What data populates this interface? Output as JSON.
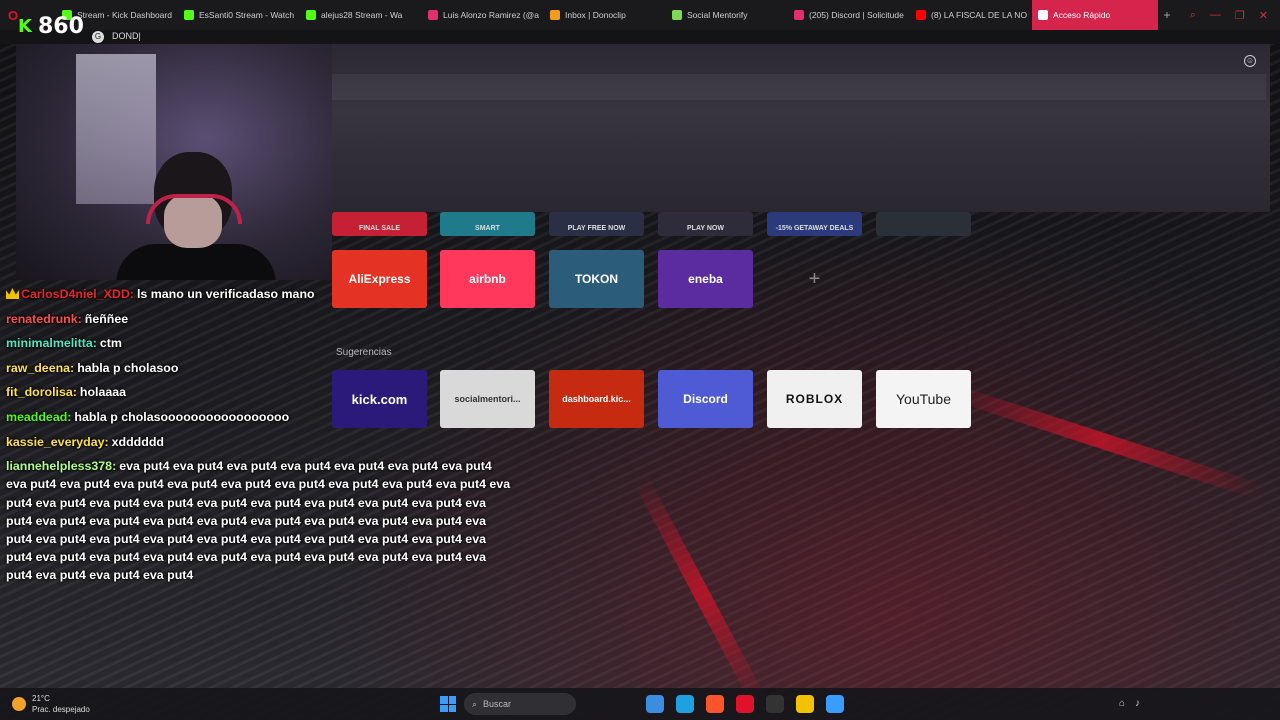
{
  "browser": {
    "tabs": [
      {
        "label": "Stream - Kick Dashboard",
        "color": "#53fc18"
      },
      {
        "label": "EsSanti0 Stream - Watch",
        "color": "#53fc18"
      },
      {
        "label": "alejus28 Stream - Wa",
        "color": "#53fc18"
      },
      {
        "label": "Luis Alonzo Ramirez (@a",
        "color": "#e1306c"
      },
      {
        "label": "Inbox | Donoclip",
        "color": "#f29b1d"
      },
      {
        "label": "Social Mentorify",
        "color": "#7ed957"
      },
      {
        "label": "(205) Discord | Solicitude",
        "color": "#e1306c"
      },
      {
        "label": "(8) LA FISCAL DE LA NO",
        "color": "#ff0000"
      },
      {
        "label": "Acceso Rápido",
        "color": "#ffffff"
      }
    ],
    "new_tab_symbol": "+",
    "window_controls": [
      "⌕",
      "—",
      "❐",
      "✕"
    ],
    "address_text": "DOND|",
    "address_icon": "G"
  },
  "stream_overlay": {
    "viewer_count": "860",
    "platform_icon": "K"
  },
  "speed_dial": {
    "partial_tiles": [
      {
        "label": "FINAL SALE",
        "color": "#c62034"
      },
      {
        "label": "SMART",
        "color": "#1f7a8c"
      },
      {
        "label": "PLAY FREE NOW",
        "color": "#2b2f45"
      },
      {
        "label": "PLAY NOW",
        "color": "#2e2c3a"
      },
      {
        "label": "-15% GETAWAY DEALS",
        "color": "#2a3a7a"
      },
      {
        "label": "",
        "color": "#2b2f38"
      }
    ],
    "tiles": [
      {
        "label": "AliExpress",
        "color": "#e43225"
      },
      {
        "label": "airbnb",
        "color": "#ff385c"
      },
      {
        "label": "TOKON",
        "color": "#2b5d7a"
      },
      {
        "label": "eneba",
        "color": "#5b2ca0"
      },
      {
        "label": "+",
        "color": "transparent"
      }
    ],
    "suggestions_label": "Sugerencias",
    "suggestions": [
      {
        "label": "kick.com",
        "color": "#2b1a7a"
      },
      {
        "label": "socialmentori...",
        "color": "#d9d9d9"
      },
      {
        "label": "dashboard.kic...",
        "color": "#c62a10"
      },
      {
        "label": "Discord",
        "color": "#4f5bd5"
      },
      {
        "label": "ROBLOX",
        "color": "#f0f0f0"
      },
      {
        "label": "YouTube",
        "color": "#f4f4f4"
      }
    ],
    "emoji_icon": "☺"
  },
  "chat": [
    {
      "user": "CarlosD4niel_XDD:",
      "color": "#e8242c",
      "text": "ls mano un verificadaso mano",
      "crown": true
    },
    {
      "user": "renatedrunk:",
      "color": "#ff4d4d",
      "text": "ñeññee"
    },
    {
      "user": "minimalmelitta:",
      "color": "#4de8c2",
      "text": "ctm"
    },
    {
      "user": "raw_deena:",
      "color": "#ffe14d",
      "text": "habla p cholasoo"
    },
    {
      "user": "fit_dorolisa:",
      "color": "#ffe14d",
      "text": "holaaaa"
    },
    {
      "user": "meaddead:",
      "color": "#53fc18",
      "text": "habla p cholasooooooooooooooooo"
    },
    {
      "user": "kassie_everyday:",
      "color": "#ffe14d",
      "text": "xdddddd"
    },
    {
      "user": "liannehelpless378:",
      "color": "#b0ff88",
      "text": "eva put4 eva put4 eva put4 eva put4 eva put4 eva put4 eva put4 eva put4 eva put4 eva put4 eva put4 eva put4 eva put4 eva put4 eva put4 eva put4 eva put4 eva put4 eva put4 eva put4 eva put4 eva put4 eva put4 eva put4 eva put4 eva put4 eva put4 eva put4 eva put4 eva put4 eva put4 eva put4 eva put4 eva put4 eva put4 eva put4 eva put4 eva put4 eva put4 eva put4 eva put4 eva put4 eva put4 eva put4 eva put4 eva put4 eva put4 eva put4 eva put4 eva put4 eva put4 eva put4 eva put4 eva put4 eva put4 eva put4"
    }
  ],
  "taskbar": {
    "temperature": "21°C",
    "weather": "Prac. despejado",
    "search_placeholder": "Buscar",
    "apps": [
      {
        "name": "widgets",
        "color": "#3c8de0"
      },
      {
        "name": "edge",
        "color": "#1fa0e0"
      },
      {
        "name": "brave",
        "color": "#fb542b"
      },
      {
        "name": "opera",
        "color": "#e0112b"
      },
      {
        "name": "obs",
        "color": "#333333"
      },
      {
        "name": "files",
        "color": "#f2c200"
      },
      {
        "name": "apps",
        "color": "#3b9cff"
      }
    ]
  }
}
